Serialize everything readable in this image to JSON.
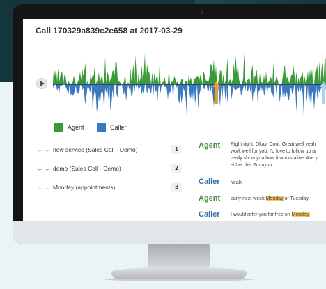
{
  "call_title": "Call 170329a839c2e658 at 2017-03-29",
  "legend": [
    {
      "label": "Agent",
      "color": "#3a9a3a"
    },
    {
      "label": "Caller",
      "color": "#3a78c0"
    }
  ],
  "topics": [
    {
      "label": "new service (Sales Call - Demo)",
      "count": "1",
      "arrow_color": "#f39c25",
      "icon": "double-arrow-icon"
    },
    {
      "label": "demo (Sales Call - Demo)",
      "count": "2",
      "arrow_color": "#8e44ad",
      "icon": "double-arrow-icon"
    },
    {
      "label": "Monday (appointments)",
      "count": "3",
      "arrow_color": "#a9d4f2",
      "icon": "double-arrow-icon"
    }
  ],
  "arrow_glyph": "← →",
  "transcript": [
    {
      "speaker": "Agent",
      "text": "Right right. Okay. Cool. Great well yeah I work well for you. I'd love to follow up ar really show you how it works alive. Are y either this Friday or"
    },
    {
      "speaker": "Caller",
      "text": "Yeah"
    },
    {
      "speaker": "Agent",
      "pre": "early next week ",
      "highlight": "Monday",
      "post": " or Tuesday"
    },
    {
      "speaker": "Caller",
      "pre": "I would refer you for free on ",
      "highlight": "Monday.",
      "post": ""
    }
  ]
}
